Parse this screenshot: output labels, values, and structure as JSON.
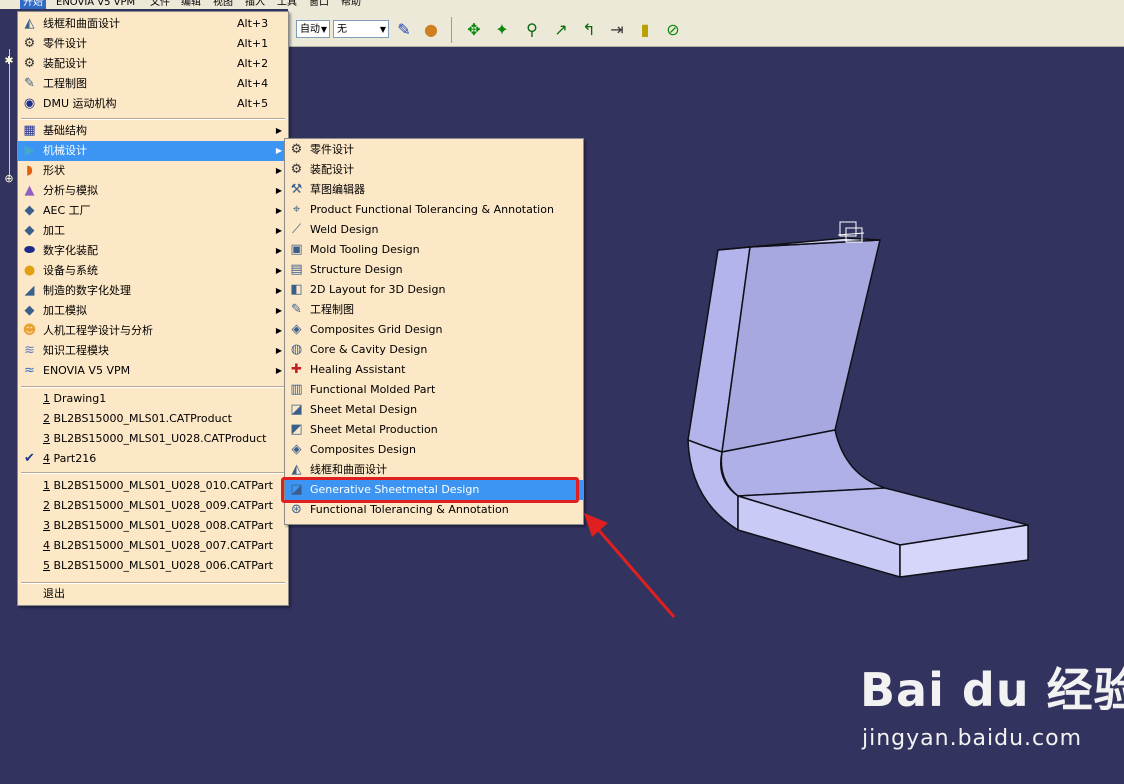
{
  "menubar": {
    "items": [
      "开始",
      "ENOVIA V5 VPM",
      "文件",
      "编辑",
      "视图",
      "插入",
      "工具",
      "窗口",
      "帮助"
    ]
  },
  "toolbar": {
    "combo1": "自动",
    "combo2": "无"
  },
  "start_menu": {
    "workbenches": [
      {
        "label": "线框和曲面设计",
        "shortcut": "Alt+3",
        "icon": "wireframe-surface-icon"
      },
      {
        "label": "零件设计",
        "shortcut": "Alt+1",
        "icon": "part-design-gear-icon"
      },
      {
        "label": "装配设计",
        "shortcut": "Alt+2",
        "icon": "assembly-gears-icon"
      },
      {
        "label": "工程制图",
        "shortcut": "Alt+4",
        "icon": "drafting-icon"
      },
      {
        "label": "DMU 运动机构",
        "shortcut": "Alt+5",
        "icon": "dmu-kinematics-icon"
      }
    ],
    "categories": [
      {
        "label": "基础结构",
        "icon": "infrastructure-icon"
      },
      {
        "label": "机械设计",
        "icon": "mechanical-design-icon"
      },
      {
        "label": "形状",
        "icon": "shape-icon"
      },
      {
        "label": "分析与模拟",
        "icon": "analysis-icon"
      },
      {
        "label": "AEC 工厂",
        "icon": "aec-plant-icon"
      },
      {
        "label": "加工",
        "icon": "machining-icon"
      },
      {
        "label": "数字化装配",
        "icon": "digital-mockup-icon"
      },
      {
        "label": "设备与系统",
        "icon": "equipment-systems-icon"
      },
      {
        "label": "制造的数字化处理",
        "icon": "digital-manufacturing-icon"
      },
      {
        "label": "加工模拟",
        "icon": "machining-simulation-icon"
      },
      {
        "label": "人机工程学设计与分析",
        "icon": "ergonomics-icon"
      },
      {
        "label": "知识工程模块",
        "icon": "knowledgeware-icon"
      },
      {
        "label": "ENOVIA V5 VPM",
        "icon": "enovia-icon"
      }
    ],
    "recent_windows": [
      {
        "num": "1",
        "label": "Drawing1"
      },
      {
        "num": "2",
        "label": "BL2BS15000_MLS01.CATProduct"
      },
      {
        "num": "3",
        "label": "BL2BS15000_MLS01_U028.CATProduct"
      },
      {
        "num": "4",
        "label": "Part216"
      }
    ],
    "recent_files": [
      {
        "num": "1",
        "label": "BL2BS15000_MLS01_U028_010.CATPart"
      },
      {
        "num": "2",
        "label": "BL2BS15000_MLS01_U028_009.CATPart"
      },
      {
        "num": "3",
        "label": "BL2BS15000_MLS01_U028_008.CATPart"
      },
      {
        "num": "4",
        "label": "BL2BS15000_MLS01_U028_007.CATPart"
      },
      {
        "num": "5",
        "label": "BL2BS15000_MLS01_U028_006.CATPart"
      }
    ],
    "exit": "退出"
  },
  "submenu": {
    "items": [
      {
        "label": "零件设计",
        "icon": "part-design-gear-icon"
      },
      {
        "label": "装配设计",
        "icon": "assembly-gears-icon"
      },
      {
        "label": "草图编辑器",
        "icon": "sketcher-icon"
      },
      {
        "label": "Product Functional Tolerancing & Annotation",
        "icon": "product-tolerancing-icon"
      },
      {
        "label": "Weld Design",
        "icon": "weld-design-icon"
      },
      {
        "label": "Mold Tooling Design",
        "icon": "mold-tooling-icon"
      },
      {
        "label": "Structure Design",
        "icon": "structure-design-icon"
      },
      {
        "label": "2D Layout for 3D Design",
        "icon": "2d-layout-icon"
      },
      {
        "label": "工程制图",
        "icon": "drafting-icon"
      },
      {
        "label": "Composites Grid Design",
        "icon": "composites-grid-icon"
      },
      {
        "label": "Core & Cavity Design",
        "icon": "core-cavity-icon"
      },
      {
        "label": "Healing Assistant",
        "icon": "healing-assistant-icon"
      },
      {
        "label": "Functional Molded Part",
        "icon": "functional-molded-part-icon"
      },
      {
        "label": "Sheet Metal Design",
        "icon": "sheet-metal-design-icon"
      },
      {
        "label": "Sheet Metal Production",
        "icon": "sheet-metal-production-icon"
      },
      {
        "label": "Composites Design",
        "icon": "composites-design-icon"
      },
      {
        "label": "线框和曲面设计",
        "icon": "wireframe-surface-icon"
      },
      {
        "label": "Generative Sheetmetal Design",
        "icon": "generative-sheetmetal-icon"
      },
      {
        "label": "Functional Tolerancing & Annotation",
        "icon": "functional-tolerancing-icon"
      }
    ]
  },
  "watermark": {
    "main": "Bai du 经验",
    "sub": "jingyan.baidu.com"
  },
  "colors": {
    "background": "#33335f",
    "menu_bg": "#fce7c6",
    "highlight": "#3d95f3",
    "annotation_red": "#e02020",
    "part_face": "#c8c8f4"
  }
}
